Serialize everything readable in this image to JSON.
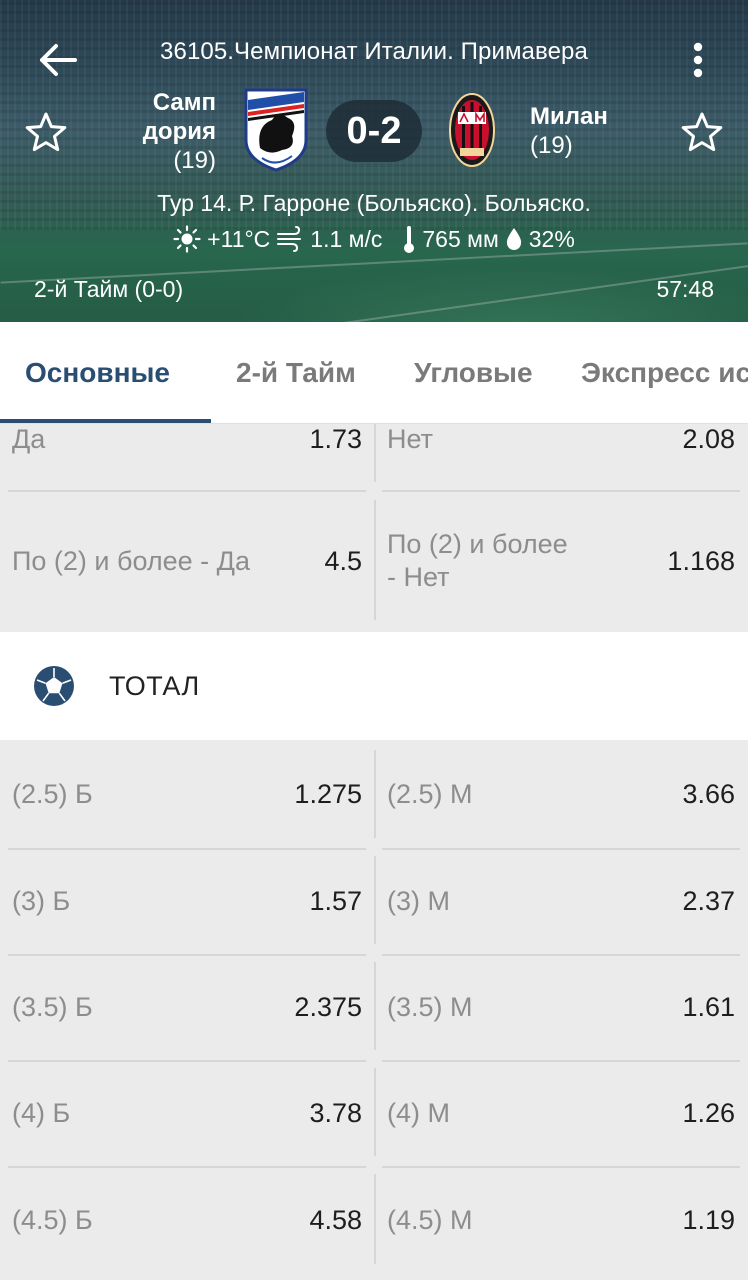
{
  "header": {
    "league": "36105.Чемпионат Италии. Примавера",
    "home_team": {
      "name_line1": "Самп",
      "name_line2": "дория",
      "rank": "(19)"
    },
    "away_team": {
      "name_line1": "Милан",
      "rank": "(19)"
    },
    "score": "0-2",
    "venue": "Тур 14. Р. Гарроне (Больяско). Больяско.",
    "weather": {
      "temperature": "+11°C",
      "wind": "1.1 м/с",
      "pressure": "765 мм",
      "humidity": "32%"
    },
    "period": "2-й  Тайм (0-0)",
    "timer": "57:48",
    "icons": {
      "back": "arrow-left-icon",
      "menu": "more-vert-icon",
      "favorite": "star-outline-icon",
      "sun": "sun-icon",
      "wind": "wind-icon",
      "thermometer": "thermometer-icon",
      "drop": "drop-icon"
    }
  },
  "tabs": [
    {
      "label": "Основные",
      "active": true
    },
    {
      "label": "2-й  Тайм",
      "active": false
    },
    {
      "label": "Угловые",
      "active": false
    },
    {
      "label": "Экспресс ис",
      "active": false
    }
  ],
  "top_odds": [
    {
      "left_label": "Да",
      "left_value": "1.73",
      "right_label": "Нет",
      "right_value": "2.08"
    },
    {
      "left_label": "По (2) и более - Да",
      "left_value": "4.5",
      "right_label_line1": "По (2) и более",
      "right_label_line2": "- Нет",
      "right_value": "1.168"
    }
  ],
  "total_section": {
    "title": "ТОТАЛ",
    "icon": "soccer-ball-icon",
    "rows": [
      {
        "left_label": "(2.5) Б",
        "left_value": "1.275",
        "right_label": "(2.5) М",
        "right_value": "3.66"
      },
      {
        "left_label": "(3) Б",
        "left_value": "1.57",
        "right_label": "(3) М",
        "right_value": "2.37"
      },
      {
        "left_label": "(3.5) Б",
        "left_value": "2.375",
        "right_label": "(3.5) М",
        "right_value": "1.61"
      },
      {
        "left_label": "(4) Б",
        "left_value": "3.78",
        "right_label": "(4) М",
        "right_value": "1.26"
      },
      {
        "left_label": "(4.5) Б",
        "left_value": "4.58",
        "right_label": "(4.5) М",
        "right_value": "1.19"
      }
    ]
  },
  "colors": {
    "accent": "#2a4e72",
    "odds_background": "#ebebeb",
    "label_gray": "#8d8d8d"
  }
}
